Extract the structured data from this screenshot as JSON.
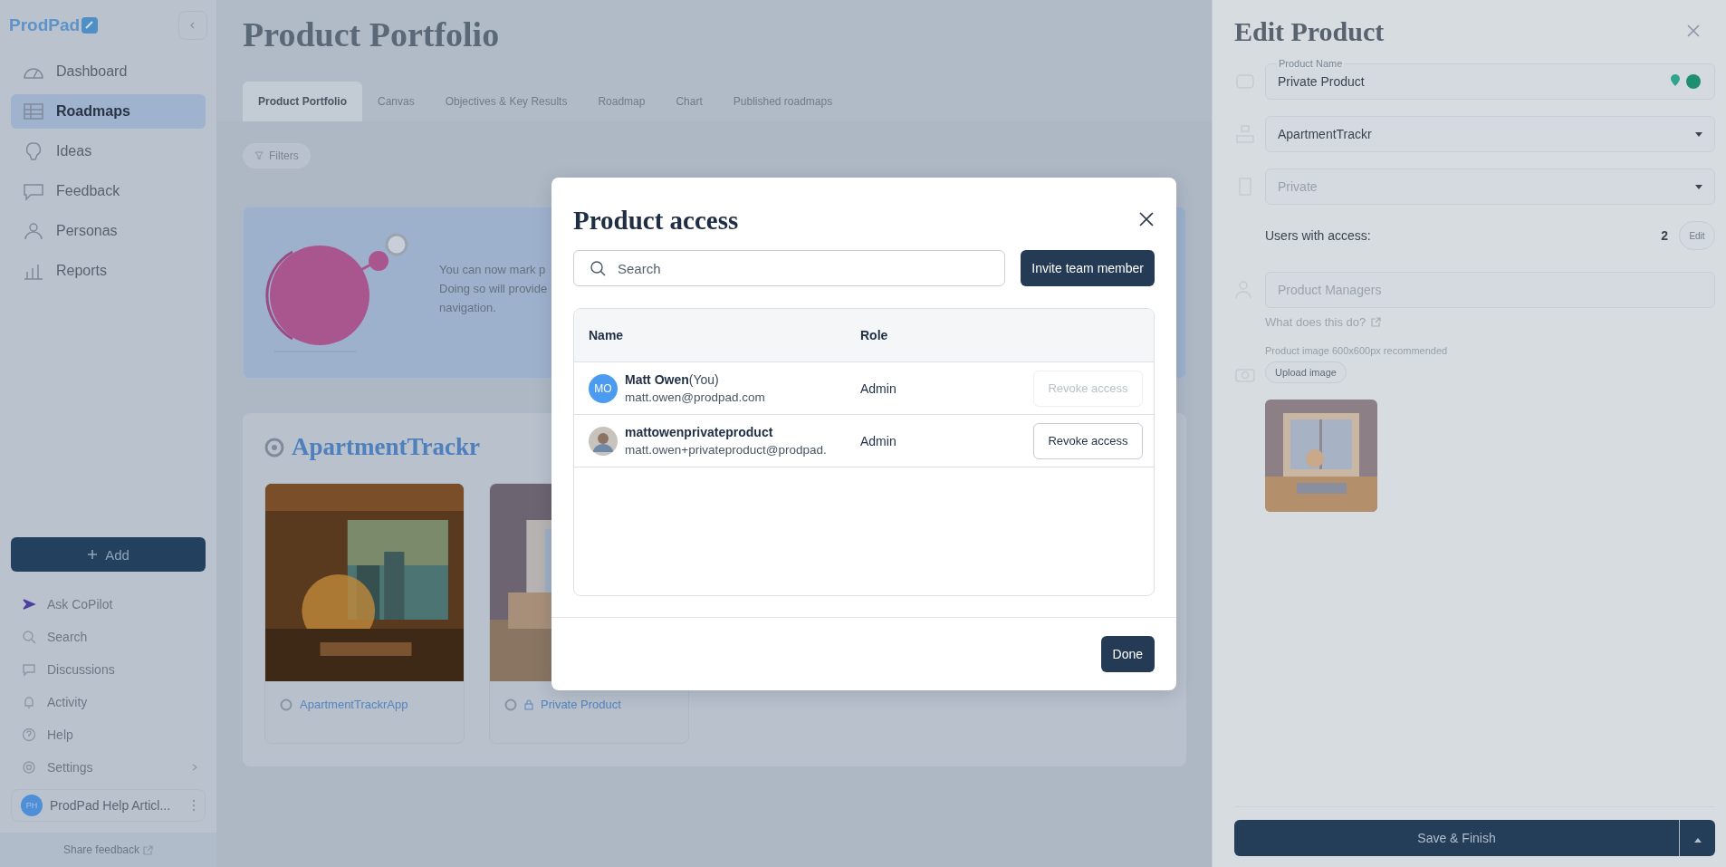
{
  "sidebar": {
    "logo": "ProdPad",
    "nav": [
      {
        "label": "Dashboard",
        "selected": false
      },
      {
        "label": "Roadmaps",
        "selected": true
      },
      {
        "label": "Ideas",
        "selected": false
      },
      {
        "label": "Feedback",
        "selected": false
      },
      {
        "label": "Personas",
        "selected": false
      },
      {
        "label": "Reports",
        "selected": false
      }
    ],
    "add_button": "Add",
    "bottom_items": [
      {
        "label": "Ask CoPilot",
        "kind": "copilot"
      },
      {
        "label": "Search",
        "kind": "search"
      },
      {
        "label": "Discussions",
        "kind": "chat"
      },
      {
        "label": "Activity",
        "kind": "bell"
      },
      {
        "label": "Help",
        "kind": "help"
      },
      {
        "label": "Settings",
        "kind": "settings"
      }
    ],
    "workspace": {
      "initials": "PH",
      "name": "ProdPad Help Articl..."
    },
    "share_feedback": "Share feedback"
  },
  "page": {
    "title": "Product Portfolio",
    "tabs": [
      {
        "label": "Product Portfolio",
        "selected": true
      },
      {
        "label": "Canvas",
        "selected": false
      },
      {
        "label": "Objectives & Key Results",
        "selected": false
      },
      {
        "label": "Roadmap",
        "selected": false
      },
      {
        "label": "Chart",
        "selected": false
      },
      {
        "label": "Published roadmaps",
        "selected": false
      }
    ],
    "filters": "Filters",
    "banner": {
      "lines": [
        "You can now mark p",
        "Doing so will provide",
        "navigation."
      ]
    },
    "portfolio": {
      "title": "ApartmentTrackr",
      "products": [
        {
          "name": "ApartmentTrackrApp",
          "locked": false
        },
        {
          "name": "Private Product",
          "locked": true
        }
      ]
    }
  },
  "edit_panel": {
    "title": "Edit Product",
    "product_name": {
      "label": "Product Name",
      "value": "Private Product"
    },
    "portfolio_select": {
      "value": "ApartmentTrackr",
      "disabled": false
    },
    "visibility_select": {
      "value": "Private",
      "disabled": true
    },
    "users_label": "Users with access:",
    "users_count": "2",
    "edit_button": "Edit",
    "team_field": {
      "placeholder": "Product Managers"
    },
    "help_link": "What does this do?",
    "image_hint": "Product image 600x600px recommended",
    "upload_button": "Upload image",
    "save_button": "Save & Finish"
  },
  "modal": {
    "title": "Product access",
    "search": {
      "placeholder": "Search"
    },
    "invite_button": "Invite team member",
    "columns": [
      "Name",
      "Role"
    ],
    "rows": [
      {
        "kind": "initials",
        "avatar": "MO",
        "name": "Matt Owen",
        "suffix": "(You)",
        "email": "matt.owen@prodpad.com",
        "role": "Admin",
        "revoke": "Revoke access",
        "disabled": true
      },
      {
        "name": "mattowenprivateproduct",
        "email": "matt.owen+privateproduct@prodpad.",
        "role": "Admin",
        "revoke": "Revoke access",
        "disabled": false
      }
    ],
    "done_button": "Done"
  }
}
